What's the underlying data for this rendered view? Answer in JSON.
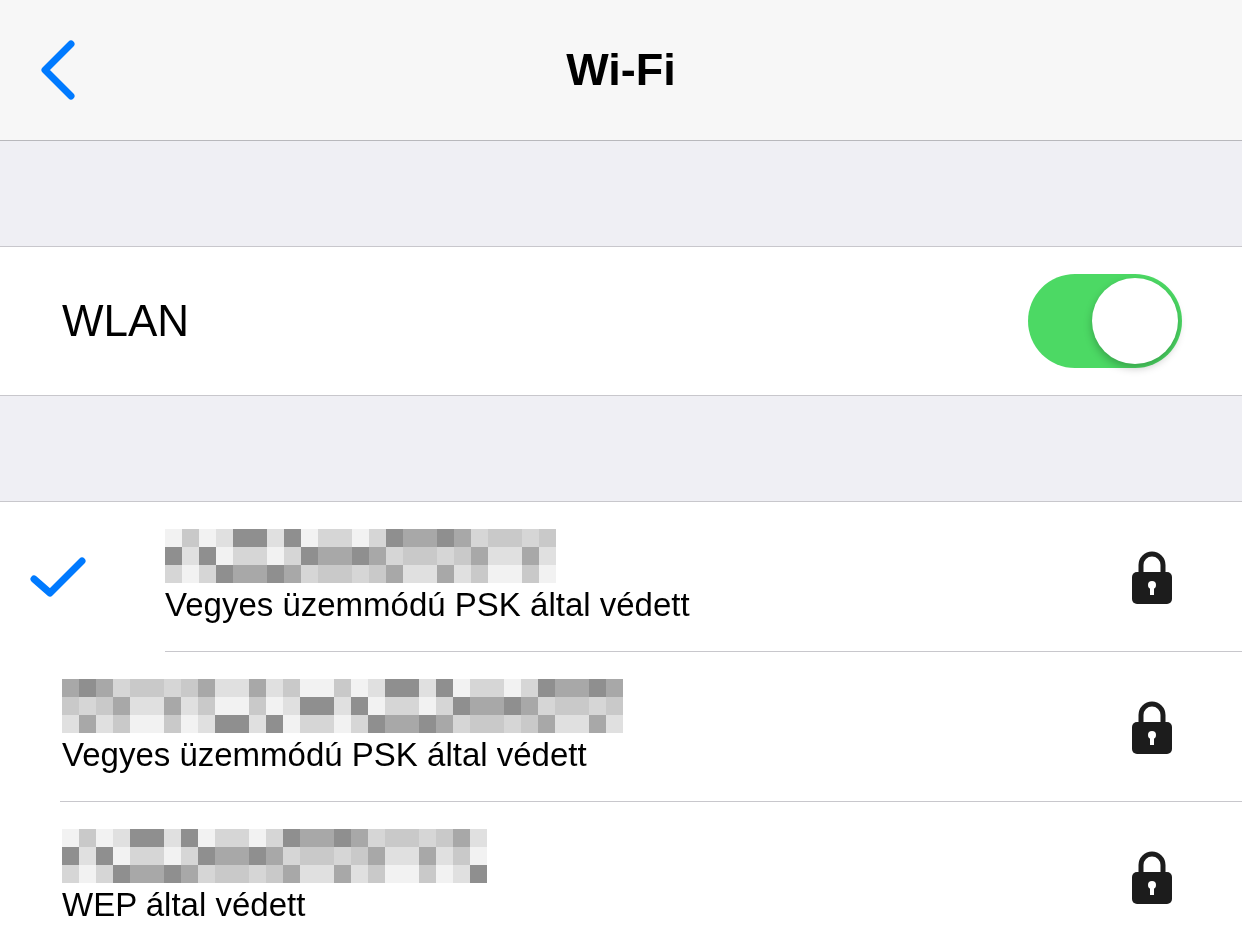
{
  "nav_bar": {
    "title": "Wi-Fi"
  },
  "wlan": {
    "label": "WLAN",
    "on": true
  },
  "networks": [
    {
      "security": "Vegyes üzemmódú PSK által védett",
      "selected": true,
      "locked": true
    },
    {
      "security": "Vegyes üzemmódú PSK által védett",
      "selected": false,
      "locked": true
    },
    {
      "security": "WEP által védett",
      "selected": false,
      "locked": true
    }
  ]
}
